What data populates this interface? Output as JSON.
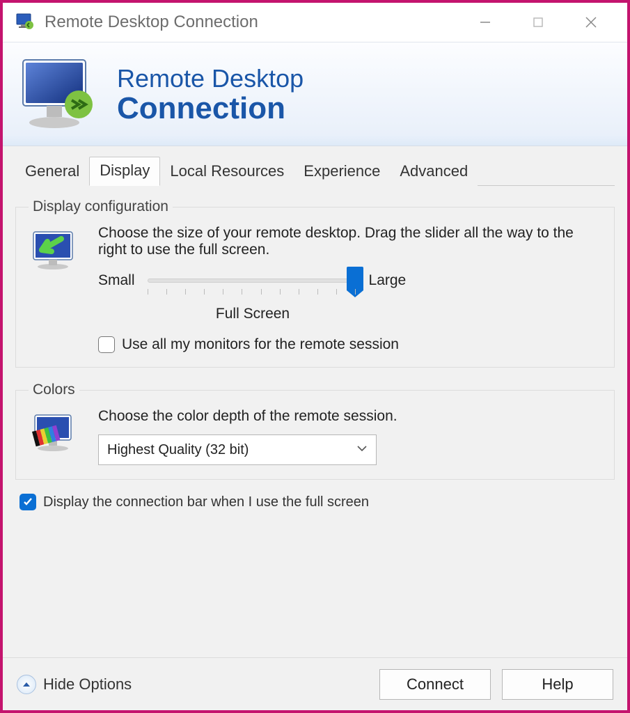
{
  "titlebar": {
    "title": "Remote Desktop Connection"
  },
  "banner": {
    "line1": "Remote Desktop",
    "line2": "Connection"
  },
  "tabs": {
    "items": [
      "General",
      "Display",
      "Local Resources",
      "Experience",
      "Advanced"
    ],
    "active_index": 1
  },
  "display_config": {
    "legend": "Display configuration",
    "description": "Choose the size of your remote desktop. Drag the slider all the way to the right to use the full screen.",
    "small_label": "Small",
    "large_label": "Large",
    "full_screen_label": "Full Screen",
    "monitors_checkbox": "Use all my monitors for the remote session",
    "monitors_checked": false
  },
  "colors": {
    "legend": "Colors",
    "description": "Choose the color depth of the remote session.",
    "selected": "Highest Quality (32 bit)"
  },
  "connection_bar": {
    "label": "Display the connection bar when I use the full screen",
    "checked": true
  },
  "footer": {
    "hide_options": "Hide Options",
    "connect": "Connect",
    "help": "Help"
  }
}
